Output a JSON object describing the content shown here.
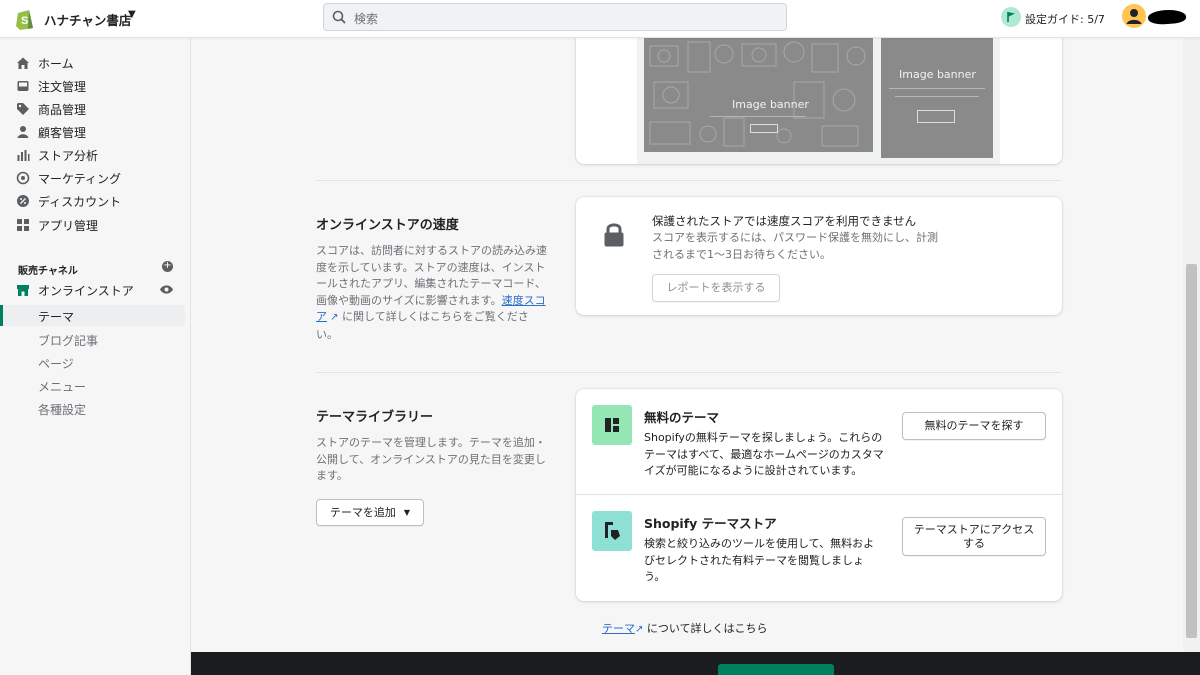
{
  "header": {
    "store_name": "ハナチャン書店",
    "search_placeholder": "検索",
    "setup_guide": "設定ガイド: 5/7"
  },
  "sidebar": {
    "items": [
      {
        "label": "ホーム",
        "icon": "home-icon"
      },
      {
        "label": "注文管理",
        "icon": "inbox-icon"
      },
      {
        "label": "商品管理",
        "icon": "tag-icon"
      },
      {
        "label": "顧客管理",
        "icon": "person-icon"
      },
      {
        "label": "ストア分析",
        "icon": "bar-chart-icon"
      },
      {
        "label": "マーケティング",
        "icon": "target-icon"
      },
      {
        "label": "ディスカウント",
        "icon": "discount-icon"
      },
      {
        "label": "アプリ管理",
        "icon": "apps-icon"
      }
    ],
    "sales_channels_title": "販売チャネル",
    "online_store": "オンラインストア",
    "sub_items": [
      "テーマ",
      "ブログ記事",
      "ページ",
      "メニュー",
      "各種設定"
    ]
  },
  "preview": {
    "banner_big": "Image banner",
    "banner_small": "Image banner"
  },
  "speed": {
    "heading": "オンラインストアの速度",
    "desc_before": "スコアは、訪問者に対するストアの読み込み速度を示しています。ストアの速度は、インストールされたアプリ、編集されたテーマコード、画像や動画のサイズに影響されます。",
    "desc_link": "速度スコア",
    "desc_after": " に関して詳しくはこちらをご覧ください。",
    "card_title": "保護されたストアでは速度スコアを利用できません",
    "card_desc": "スコアを表示するには、パスワード保護を無効にし、計測されるまで1〜3日お待ちください。",
    "report_button": "レポートを表示する"
  },
  "library": {
    "heading": "テーマライブラリー",
    "desc": "ストアのテーマを管理します。テーマを追加・公開して、オンラインストアの見た目を変更します。",
    "add_button": "テーマを追加",
    "free_title": "無料のテーマ",
    "free_desc": "Shopifyの無料テーマを探しましょう。これらのテーマはすべて、最適なホームページのカスタマイズが可能になるように設計されています。",
    "free_button": "無料のテーマを探す",
    "store_title": "Shopify テーマストア",
    "store_desc": "検索と絞り込みのツールを使用して、無料およびセレクトされた有料テーマを閲覧しましょう。",
    "store_button": "テーマストアにアクセスする"
  },
  "footer": {
    "link": "テーマ",
    "text": " について詳しくはこちら"
  },
  "colors": {
    "accent": "#008060",
    "link": "#2c6ecb",
    "free_icon_bg": "#95e6b5",
    "store_icon_bg": "#8fe0d4"
  }
}
